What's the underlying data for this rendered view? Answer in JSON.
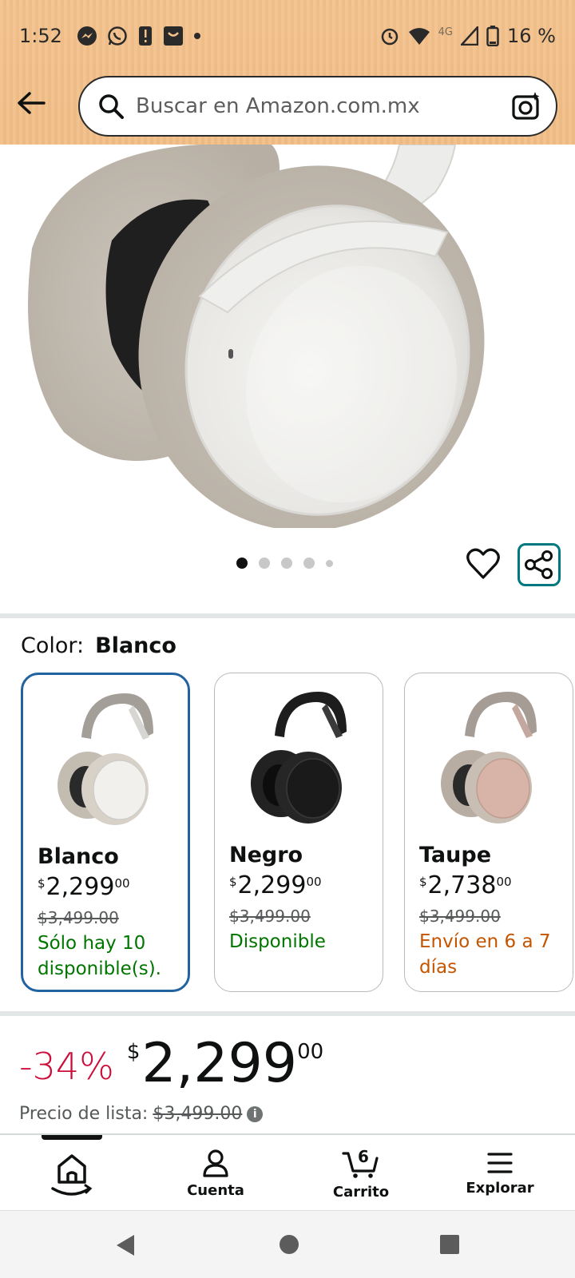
{
  "status_bar": {
    "time": "1:52",
    "network": "4G",
    "battery": "16 %"
  },
  "search": {
    "placeholder": "Buscar en Amazon.com.mx"
  },
  "carousel": {
    "dot_count": 5,
    "active_index": 0
  },
  "color_selector": {
    "label": "Color:",
    "selected": "Blanco"
  },
  "variants": [
    {
      "name": "Blanco",
      "currency": "$",
      "price_whole": "2,299",
      "price_cents": "00",
      "list_price": "$3,499.00",
      "availability_lines": [
        "Sólo hay 10",
        "disponible(s)."
      ],
      "availability_color": "#007600"
    },
    {
      "name": "Negro",
      "currency": "$",
      "price_whole": "2,299",
      "price_cents": "00",
      "list_price": "$3,499.00",
      "availability_lines": [
        "Disponible"
      ],
      "availability_color": "#007600"
    },
    {
      "name": "Taupe",
      "currency": "$",
      "price_whole": "2,738",
      "price_cents": "00",
      "list_price": "$3,499.00",
      "availability_lines": [
        "Envío en 6 a 7",
        "días"
      ],
      "availability_color": "#c45500"
    }
  ],
  "pricing": {
    "discount": "-34%",
    "currency": "$",
    "price_whole": "2,299",
    "price_cents": "00",
    "list_label": "Precio de lista:",
    "list_price": "$3,499.00"
  },
  "bottom_nav": {
    "items": [
      {
        "label": "",
        "icon": "home-icon"
      },
      {
        "label": "Cuenta",
        "icon": "account-icon"
      },
      {
        "label": "Carrito",
        "icon": "cart-icon",
        "badge": "6"
      },
      {
        "label": "Explorar",
        "icon": "menu-icon"
      }
    ]
  },
  "colors": {
    "header": "#f3c28c",
    "selected_border": "#2162a1",
    "discount": "#cc0c39",
    "in_stock": "#007600",
    "shipping": "#c45500",
    "share_accent": "#00787f"
  }
}
